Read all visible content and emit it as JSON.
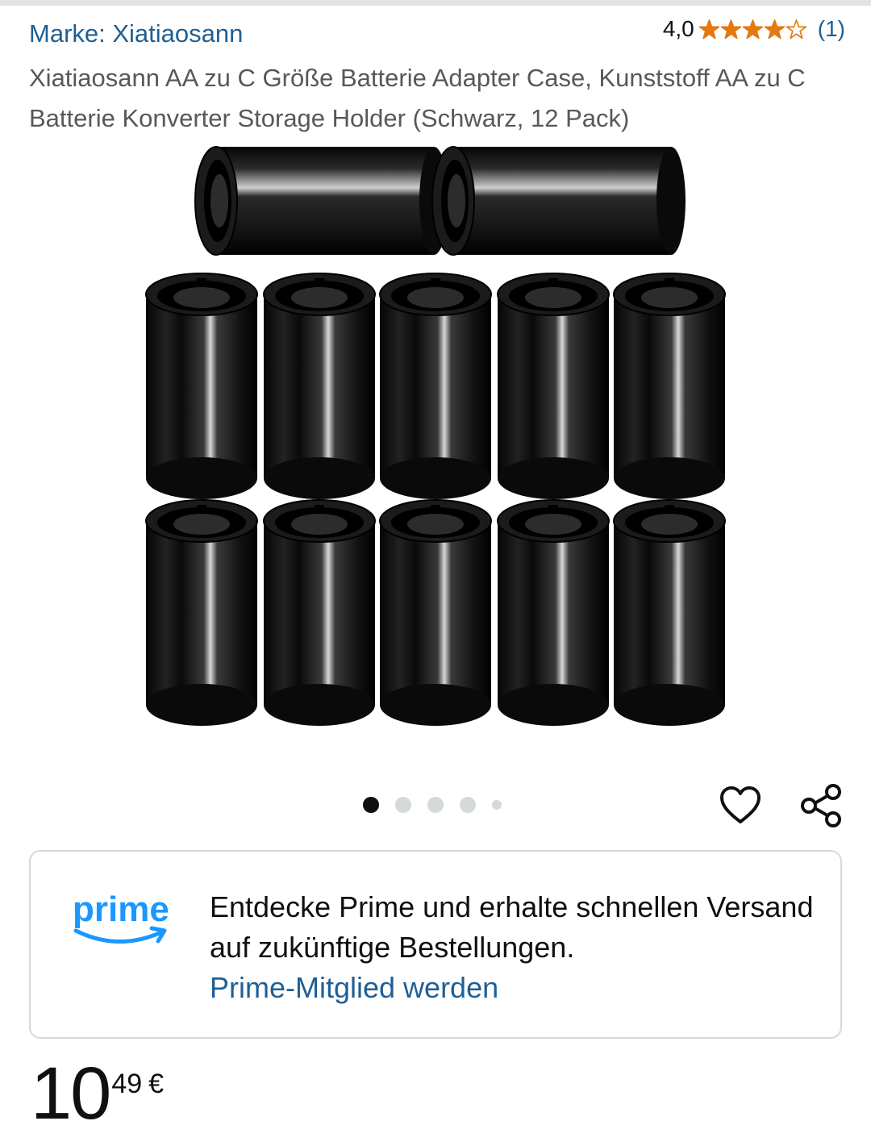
{
  "header": {
    "brand_link": "Marke: Xiatiaosann",
    "rating_value": "4,0",
    "rating_stars": 4,
    "rating_max": 5,
    "rating_count": "(1)",
    "title": "Xiatiaosann AA zu C Größe Batterie Adapter Case, Kunststoff AA zu C Batterie Konverter Storage Holder (Schwarz, 12 Pack)"
  },
  "gallery": {
    "image_count": 5,
    "active_index": 0,
    "image_icon": "black-battery-adapters-image"
  },
  "actions": {
    "wishlist_icon": "heart-icon",
    "share_icon": "share-icon"
  },
  "prime_banner": {
    "logo_text": "prime",
    "text": "Entdecke Prime und erhalte schnellen Versand auf zukünftige Bestellungen.",
    "link": "Prime-Mitglied werden"
  },
  "price": {
    "whole": "10",
    "fraction": "49",
    "currency": "€"
  },
  "colors": {
    "link": "#1f5f95",
    "star": "#e47911",
    "prime_blue": "#1a98ff"
  }
}
